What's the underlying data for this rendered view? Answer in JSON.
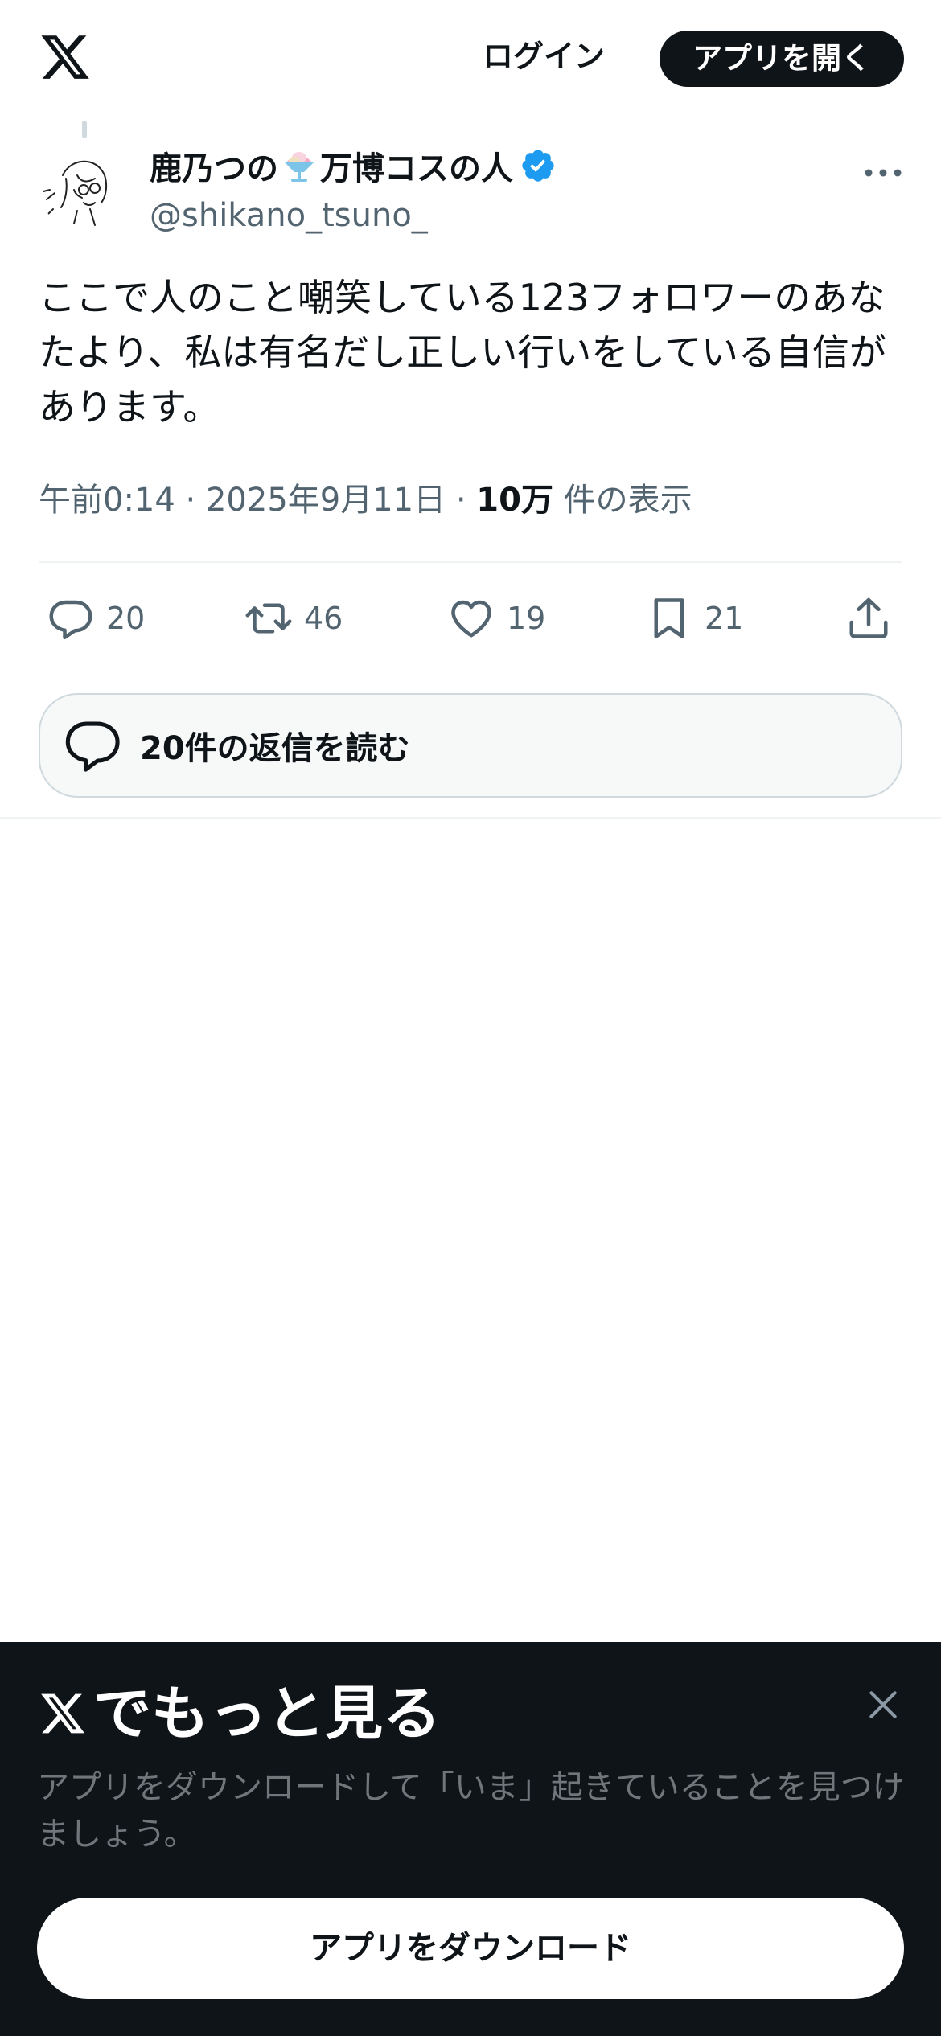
{
  "header": {
    "login_label": "ログイン",
    "open_app_label": "アプリを開く"
  },
  "tweet": {
    "display_name_part1": "鹿乃つの",
    "display_name_part2": "万博コスの人",
    "handle": "@shikano_tsuno_",
    "text": "ここで人のこと嘲笑している123フォロワーのあなたより、私は有名だし正しい行いをしている自信があります。",
    "time": "午前0:14",
    "separator": "·",
    "date": "2025年9月11日",
    "views_count": "10万",
    "views_label": "件の表示"
  },
  "actions": {
    "replies": "20",
    "reposts": "46",
    "likes": "19",
    "bookmarks": "21"
  },
  "read_replies_label": "20件の返信を読む",
  "bottom_sheet": {
    "title": "でもっと見る",
    "subtitle": "アプリをダウンロードして「いま」起きていることを見つけましょう。",
    "download_label": "アプリをダウンロード"
  },
  "colors": {
    "text_primary": "#0f1419",
    "text_secondary": "#536471",
    "verified_blue": "#1d9bf0",
    "sheet_background": "#0f1419"
  }
}
